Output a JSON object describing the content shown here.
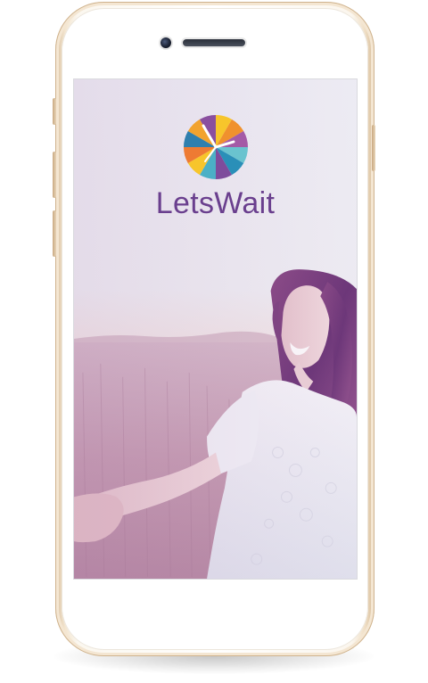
{
  "app": {
    "brand_part1": "Lets",
    "brand_part2": "Wait"
  },
  "colors": {
    "brand_purple": "#6a3f8e",
    "screen_bg": "#f1f3f8",
    "phone_gold": "#e8d4b8"
  },
  "icons": {
    "logo": "clock-wheel-icon",
    "camera": "front-camera-icon",
    "speaker": "earpiece-speaker-icon"
  }
}
